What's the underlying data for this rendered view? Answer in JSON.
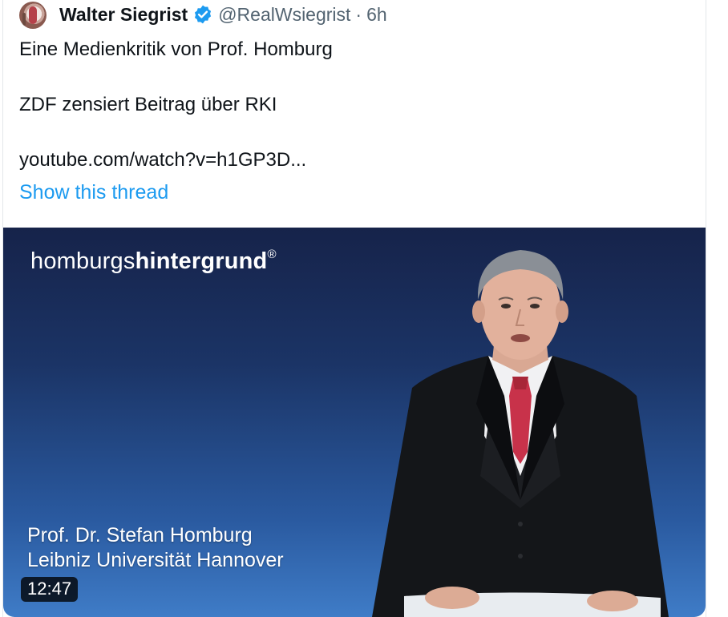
{
  "tweet": {
    "author_name": "Walter Siegrist",
    "handle": "@RealWsiegrist",
    "separator": "·",
    "time": "6h",
    "verified_color": "#1d9bf0",
    "lines": [
      "Eine Medienkritik von Prof. Homburg",
      "ZDF zensiert Beitrag über RKI",
      "youtube.com/watch?v=h1GP3D..."
    ],
    "show_thread": "Show this thread"
  },
  "media": {
    "brand_light": "homburgs",
    "brand_bold": "hintergrund",
    "brand_mark": "®",
    "caption_name": "Prof. Dr. Stefan Homburg",
    "caption_affiliation": "Leibniz Universität Hannover",
    "duration": "12:47"
  }
}
